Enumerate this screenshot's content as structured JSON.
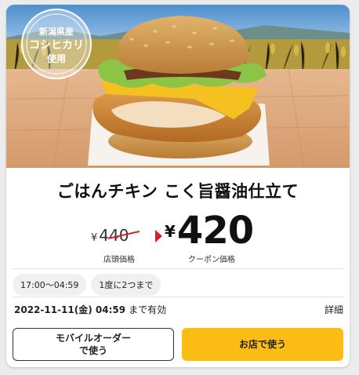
{
  "product": {
    "title": "ごはんチキン こく旨醤油仕立て",
    "badge_lines": [
      "新潟県産",
      "コシヒカリ",
      "使用"
    ]
  },
  "price": {
    "original_yen": "¥",
    "original_value": "440",
    "original_label": "店頭価格",
    "coupon_yen": "¥",
    "coupon_value": "420",
    "coupon_label": "クーポン価格",
    "accent_color": "#d61f26"
  },
  "conditions": {
    "time_range": "17:00〜04:59",
    "limit": "1度に2つまで"
  },
  "validity": {
    "date": "2022-11-11(金) 04:59",
    "suffix": "まで有効",
    "detail_link": "詳細"
  },
  "buttons": {
    "mobile_order_line1": "モバイルオーダー",
    "mobile_order_line2": "で使う",
    "use_in_store": "お店で使う",
    "store_color": "#fbbd15"
  }
}
